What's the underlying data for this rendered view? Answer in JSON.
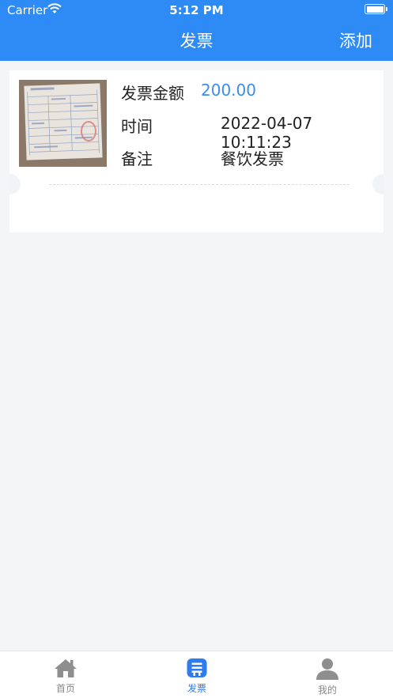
{
  "status_bar": {
    "carrier": "Carrier",
    "time": "5:12 PM"
  },
  "nav": {
    "title": "发票",
    "add_label": "添加"
  },
  "invoice": {
    "amount_label": "发票金额",
    "amount": "200.00",
    "time_label": "时间",
    "time": "2022-04-07 10:11:23",
    "remark_label": "备注",
    "remark": "餐饮发票"
  },
  "tabbar": {
    "items": [
      {
        "label": "首页",
        "icon": "home-icon",
        "active": false
      },
      {
        "label": "发票",
        "icon": "invoice-icon",
        "active": true
      },
      {
        "label": "我的",
        "icon": "user-icon",
        "active": false
      }
    ]
  },
  "colors": {
    "accent": "#2e8bf6",
    "amount": "#3b8de8",
    "active_tab": "#2e7cf0",
    "background": "#f4f5f7"
  }
}
